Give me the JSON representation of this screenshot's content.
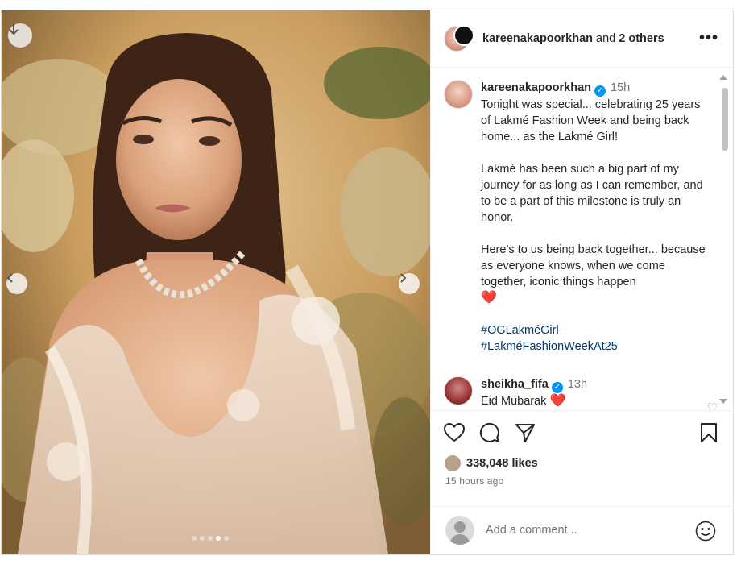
{
  "post": {
    "header": {
      "author": "kareenakapoorkhan",
      "collab_joiner": "and",
      "collab_others": "2 others",
      "more_icon": "more-horizontal-icon"
    },
    "caption": {
      "username": "kareenakapoorkhan",
      "time": "15h",
      "paragraphs": [
        "Tonight was special... celebrating 25 years of Lakmé Fashion Week and being back home... as the Lakmé Girl!",
        "Lakmé has been such a big part of my journey for as long as I can remember, and to be a part of this milestone is truly an honor.",
        "Here’s to us being back together... because as everyone knows, when we come together, iconic things happen"
      ],
      "heart_emoji": "❤️",
      "hashtags": [
        "#OGLakméGirl",
        "#LakméFashionWeekAt25"
      ]
    },
    "comments": [
      {
        "username": "sheikha_fifa",
        "time": "13h",
        "text": "Eid Mubarak",
        "emoji": "❤️"
      }
    ],
    "likes": "338,048 likes",
    "posted_ago": "15 hours ago",
    "add_comment_placeholder": "Add a comment...",
    "carousel": {
      "total": 5,
      "active_index": 3
    },
    "colors": {
      "accent_blue": "#0095f6",
      "hashtag": "#00376b",
      "heart": "#e0112f"
    },
    "icons": [
      "download-icon",
      "chevron-left-icon",
      "chevron-right-icon",
      "heart-icon",
      "comment-icon",
      "share-icon",
      "bookmark-icon",
      "emoji-icon"
    ]
  }
}
